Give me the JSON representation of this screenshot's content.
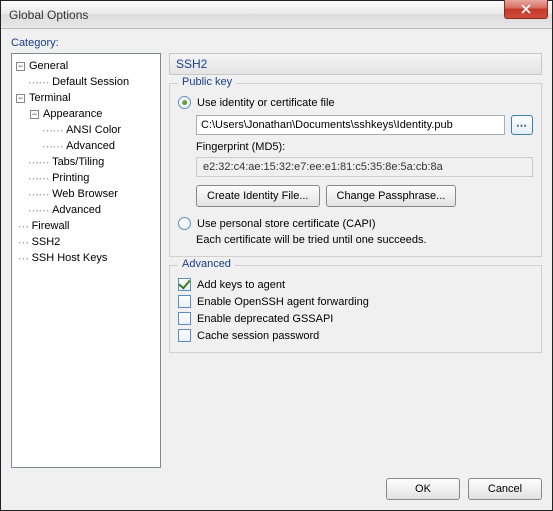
{
  "window": {
    "title": "Global Options"
  },
  "labels": {
    "category": "Category:"
  },
  "tree": {
    "general": "General",
    "default_session": "Default Session",
    "terminal": "Terminal",
    "appearance": "Appearance",
    "ansi_color": "ANSI Color",
    "advanced": "Advanced",
    "tabs_tiling": "Tabs/Tiling",
    "printing": "Printing",
    "web_browser": "Web Browser",
    "advanced2": "Advanced",
    "firewall": "Firewall",
    "ssh2": "SSH2",
    "ssh_host_keys": "SSH Host Keys"
  },
  "panel": {
    "title": "SSH2"
  },
  "publickey": {
    "group_title": "Public key",
    "use_identity": "Use identity or certificate file",
    "path": "C:\\Users\\Jonathan\\Documents\\sshkeys\\Identity.pub",
    "fingerprint_label": "Fingerprint (MD5):",
    "fingerprint": "e2:32:c4:ae:15:32:e7:ee:e1:81:c5:35:8e:5a:cb:8a",
    "create_identity": "Create Identity File...",
    "change_passphrase": "Change Passphrase...",
    "use_capi": "Use personal store certificate (CAPI)",
    "capi_note": "Each certificate will be tried until one succeeds."
  },
  "advanced": {
    "group_title": "Advanced",
    "add_keys": "Add keys to agent",
    "openssh_fwd": "Enable OpenSSH agent forwarding",
    "gssapi": "Enable deprecated GSSAPI",
    "cache_pwd": "Cache session password"
  },
  "footer": {
    "ok": "OK",
    "cancel": "Cancel"
  }
}
